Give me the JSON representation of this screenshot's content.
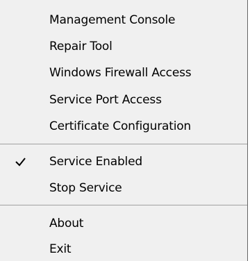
{
  "menu": {
    "items": [
      {
        "label": "Management Console"
      },
      {
        "label": "Repair Tool"
      },
      {
        "label": "Windows Firewall Access"
      },
      {
        "label": "Service Port Access"
      },
      {
        "label": "Certificate Configuration"
      },
      {
        "label": "Service Enabled",
        "checked": true
      },
      {
        "label": "Stop Service"
      },
      {
        "label": "About"
      },
      {
        "label": "Exit"
      }
    ]
  },
  "icons": {
    "checkmark": "checkmark-icon"
  }
}
